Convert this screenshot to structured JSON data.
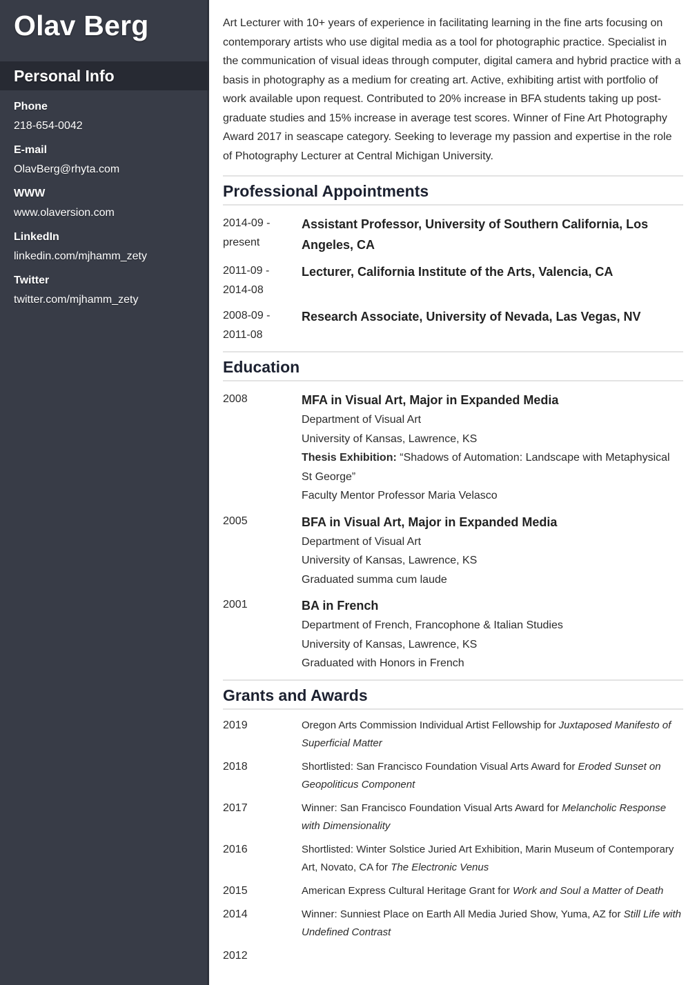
{
  "sidebar": {
    "name": "Olav Berg",
    "personal_info_heading": "Personal Info",
    "contacts": [
      {
        "label": "Phone",
        "value": "218-654-0042"
      },
      {
        "label": "E-mail",
        "value": "OlavBerg@rhyta.com"
      },
      {
        "label": "WWW",
        "value": "www.olaversion.com"
      },
      {
        "label": "LinkedIn",
        "value": "linkedin.com/mjhamm_zety"
      },
      {
        "label": "Twitter",
        "value": "twitter.com/mjhamm_zety"
      }
    ]
  },
  "summary": "Art Lecturer with 10+ years of experience in facilitating learning in the fine arts focusing on contemporary artists who use digital media as a tool for photographic practice. Specialist in the communication of visual ideas through computer, digital camera and hybrid practice with a basis in photography as a medium for creating art. Active, exhibiting artist with portfolio of work available upon request. Contributed to 20% increase in BFA students taking up post-graduate studies and 15% increase in average test scores. Winner of Fine Art Photography Award 2017 in seascape category. Seeking to leverage my passion and expertise in the role of Photography Lecturer at Central Michigan University.",
  "appointments": {
    "heading": "Professional Appointments",
    "items": [
      {
        "date_start": "2014-09 -",
        "date_end": "present",
        "title": "Assistant Professor, University of Southern California, Los Angeles, CA"
      },
      {
        "date_start": "2011-09 -",
        "date_end": "2014-08",
        "title": "Lecturer, California Institute of the Arts, Valencia, CA"
      },
      {
        "date_start": "2008-09 -",
        "date_end": "2011-08",
        "title": "Research Associate, University of Nevada, Las Vegas, NV"
      }
    ]
  },
  "education": {
    "heading": "Education",
    "items": [
      {
        "year": "2008",
        "degree": "MFA in Visual Art, Major in Expanded Media",
        "department": "Department of Visual Art",
        "school": "University of Kansas, Lawrence, KS",
        "thesis_label": "Thesis Exhibition:",
        "thesis_value": "“Shadows of Automation: Landscape with Metaphysical St George”",
        "note": "Faculty Mentor Professor Maria Velasco"
      },
      {
        "year": "2005",
        "degree": "BFA in Visual Art, Major in Expanded Media",
        "department": "Department of Visual Art",
        "school": "University of Kansas, Lawrence, KS",
        "note": "Graduated summa cum laude"
      },
      {
        "year": "2001",
        "degree": "BA in French",
        "department": "Department of French, Francophone & Italian Studies",
        "school": "University of Kansas, Lawrence, KS",
        "note": "Graduated with Honors in French"
      }
    ]
  },
  "awards": {
    "heading": "Grants and Awards",
    "items": [
      {
        "year": "2019",
        "text": "Oregon Arts Commission Individual Artist Fellowship for ",
        "work": "Juxtaposed Manifesto of Superficial Matter"
      },
      {
        "year": "2018",
        "text": "Shortlisted: San Francisco Foundation Visual Arts Award for ",
        "work": "Eroded Sunset on Geopoliticus Component"
      },
      {
        "year": "2017",
        "text": "Winner: San Francisco Foundation Visual Arts Award for ",
        "work": "Melancholic Response with Dimensionality"
      },
      {
        "year": "2016",
        "text": "Shortlisted: Winter Solstice Juried Art Exhibition, Marin Museum of Contemporary Art, Novato, CA for ",
        "work": "The Electronic Venus"
      },
      {
        "year": "2015",
        "text": "American Express Cultural Heritage Grant for ",
        "work": "Work and Soul a Matter of Death"
      },
      {
        "year": "2014",
        "text": "Winner: Sunniest Place on Earth All Media Juried Show, Yuma, AZ for ",
        "work": "Still Life with Undefined Contrast"
      },
      {
        "year": "2012",
        "text": "",
        "work": ""
      }
    ]
  }
}
